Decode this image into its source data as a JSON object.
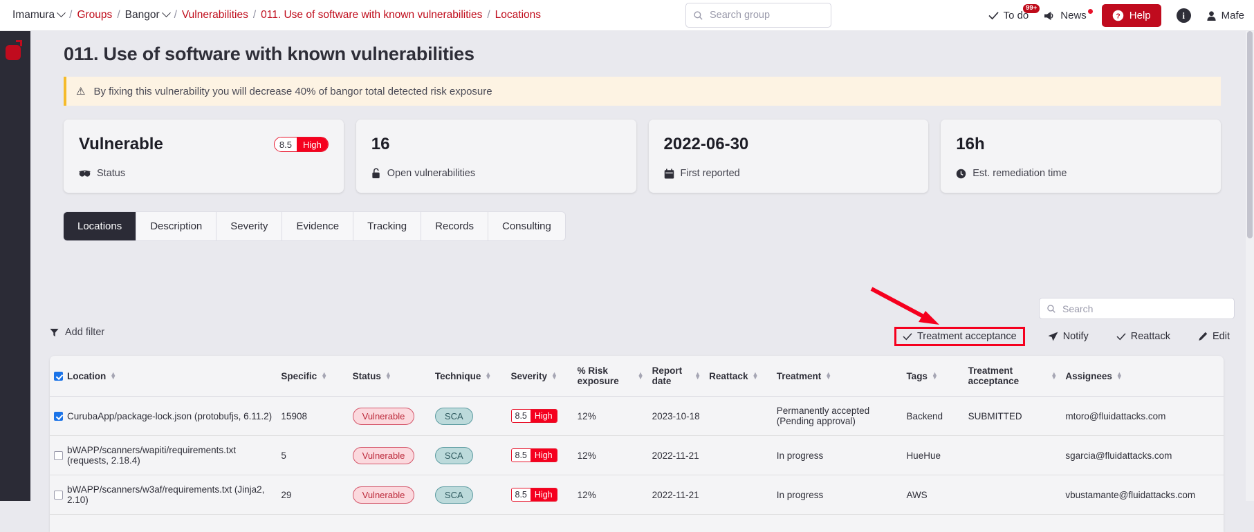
{
  "topbar": {
    "breadcrumb": [
      {
        "label": "Imamura",
        "type": "dropdown"
      },
      {
        "label": "Groups",
        "type": "link"
      },
      {
        "label": "Bangor",
        "type": "dropdown"
      },
      {
        "label": "Vulnerabilities",
        "type": "link"
      },
      {
        "label": "011. Use of software with known vulnerabilities",
        "type": "link"
      },
      {
        "label": "Locations",
        "type": "link"
      }
    ],
    "search": {
      "placeholder": "Search group",
      "value": "",
      "icon": "search-icon"
    },
    "todo": {
      "label": "To do",
      "badge": "99+",
      "icon": "check-icon"
    },
    "news": {
      "label": "News",
      "icon": "megaphone-icon",
      "has_dot": true
    },
    "help": {
      "label": "Help",
      "icon": "question-circle-icon"
    },
    "info": {
      "icon": "info-icon",
      "label": "i"
    },
    "user": {
      "label": "Mafe",
      "icon": "user-icon"
    }
  },
  "page": {
    "title": "011. Use of software with known vulnerabilities",
    "banner": {
      "icon": "warning-triangle-icon",
      "text": "By fixing this vulnerability you will decrease 40% of bangor total detected risk exposure"
    }
  },
  "cards": [
    {
      "value": "Vulnerable",
      "sub_label": "Status",
      "icon": "status-icon",
      "severity": {
        "score": "8.5",
        "level": "High"
      }
    },
    {
      "value": "16",
      "sub_label": "Open vulnerabilities",
      "icon": "lock-open-icon"
    },
    {
      "value": "2022-06-30",
      "sub_label": "First reported",
      "icon": "calendar-icon"
    },
    {
      "value": "16h",
      "sub_label": "Est. remediation time",
      "icon": "clock-icon"
    }
  ],
  "tabs": [
    {
      "label": "Locations",
      "active": true
    },
    {
      "label": "Description",
      "active": false
    },
    {
      "label": "Severity",
      "active": false
    },
    {
      "label": "Evidence",
      "active": false
    },
    {
      "label": "Tracking",
      "active": false
    },
    {
      "label": "Records",
      "active": false
    },
    {
      "label": "Consulting",
      "active": false
    }
  ],
  "toolbar": {
    "add_filter": {
      "label": "Add filter",
      "icon": "filter-icon"
    },
    "search": {
      "placeholder": "Search",
      "value": "",
      "icon": "search-icon"
    },
    "actions": [
      {
        "label": "Treatment acceptance",
        "icon": "check-icon",
        "highlighted": true
      },
      {
        "label": "Notify",
        "icon": "paper-plane-icon",
        "highlighted": false
      },
      {
        "label": "Reattack",
        "icon": "check-icon",
        "highlighted": false
      },
      {
        "label": "Edit",
        "icon": "pencil-icon",
        "highlighted": false
      }
    ]
  },
  "annotation": {
    "type": "red-arrow",
    "color": "#f5001e",
    "points_to": "Treatment acceptance"
  },
  "table": {
    "columns": [
      {
        "label": "Location",
        "sortable": true,
        "has_checkbox": true,
        "checked": true
      },
      {
        "label": "Specific",
        "sortable": true
      },
      {
        "label": "Status",
        "sortable": true
      },
      {
        "label": "Technique",
        "sortable": true
      },
      {
        "label": "Severity",
        "sortable": true
      },
      {
        "label": "% Risk exposure",
        "sortable": true
      },
      {
        "label": "Report date",
        "sortable": true
      },
      {
        "label": "Reattack",
        "sortable": true
      },
      {
        "label": "Treatment",
        "sortable": true
      },
      {
        "label": "Tags",
        "sortable": true
      },
      {
        "label": "Treatment acceptance",
        "sortable": true
      },
      {
        "label": "Assignees",
        "sortable": true
      }
    ],
    "rows": [
      {
        "checked": true,
        "location": "CurubaApp/package-lock.json (protobufjs, 6.11.2)",
        "specific": "15908",
        "status": "Vulnerable",
        "technique": "SCA",
        "severity_score": "8.5",
        "severity_level": "High",
        "risk_exposure": "12%",
        "report_date": "2023-10-18",
        "reattack": "",
        "treatment": "Permanently accepted (Pending approval)",
        "tags": "Backend",
        "treatment_acceptance": "SUBMITTED",
        "assignees": "mtoro@fluidattacks.com"
      },
      {
        "checked": false,
        "location": "bWAPP/scanners/wapiti/requirements.txt (requests, 2.18.4)",
        "specific": "5",
        "status": "Vulnerable",
        "technique": "SCA",
        "severity_score": "8.5",
        "severity_level": "High",
        "risk_exposure": "12%",
        "report_date": "2022-11-21",
        "reattack": "",
        "treatment": "In progress",
        "tags": "HueHue",
        "treatment_acceptance": "",
        "assignees": "sgarcia@fluidattacks.com"
      },
      {
        "checked": false,
        "location": "bWAPP/scanners/w3af/requirements.txt (Jinja2, 2.10)",
        "specific": "29",
        "status": "Vulnerable",
        "technique": "SCA",
        "severity_score": "8.5",
        "severity_level": "High",
        "risk_exposure": "12%",
        "report_date": "2022-11-21",
        "reattack": "",
        "treatment": "In progress",
        "tags": "AWS",
        "treatment_acceptance": "",
        "assignees": "vbustamante@fluidattacks.com"
      }
    ]
  },
  "colors": {
    "brand_red": "#c00b1e",
    "severity_high": "#f5001e",
    "sidebar_dark": "#2b2b36",
    "banner_bg": "#fdf3e3",
    "banner_accent": "#f5bb2a"
  }
}
